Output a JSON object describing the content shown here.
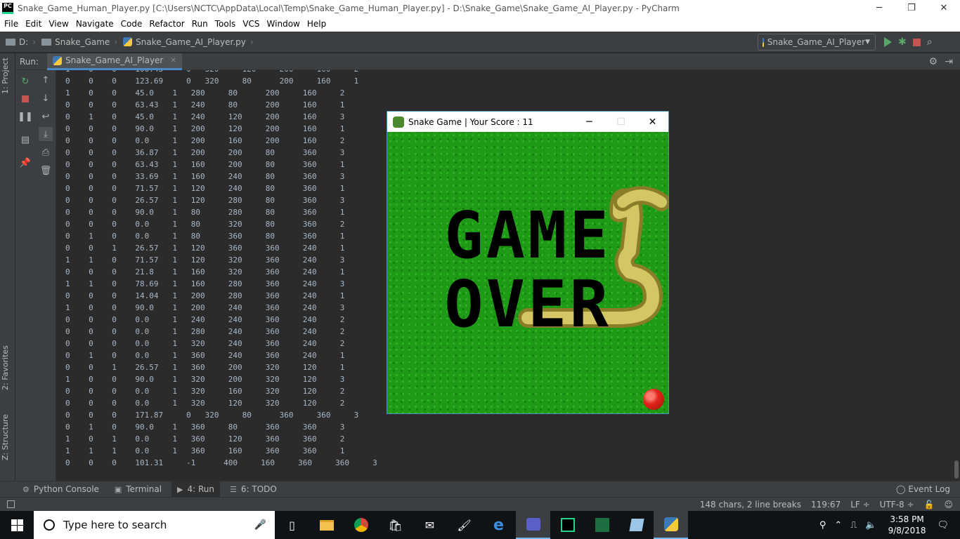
{
  "window": {
    "title": "Snake_Game_Human_Player.py [C:\\Users\\NCTC\\AppData\\Local\\Temp\\Snake_Game_Human_Player.py] - D:\\Snake_Game\\Snake_Game_AI_Player.py - PyCharm",
    "minimize": "─",
    "restore": "❐",
    "close": "✕"
  },
  "menu": [
    "File",
    "Edit",
    "View",
    "Navigate",
    "Code",
    "Refactor",
    "Run",
    "Tools",
    "VCS",
    "Window",
    "Help"
  ],
  "breadcrumb": {
    "drive": "D:",
    "folder": "Snake_Game",
    "file": "Snake_Game_AI_Player.py"
  },
  "run_config": "Snake_Game_AI_Player",
  "left_tabs": {
    "project": "1: Project",
    "favorites": "2: Favorites",
    "structure": "Z: Structure"
  },
  "run_panel": {
    "label": "Run:",
    "tab": "Snake_Game_AI_Player"
  },
  "console_lines": [
    "0    0    0    123.69     0   320     80      200     160     1",
    "1    0    0    45.0    1   280     80      200     160     2",
    "0    0    0    63.43   1   240     80      200     160     1",
    "0    1    0    45.0    1   240     120     200     160     3",
    "0    0    0    90.0    1   200     120     200     160     1",
    "0    0    0    0.0     1   200     160     200     160     2",
    "0    0    0    36.87   1   200     200     80      360     3",
    "0    0    0    63.43   1   160     200     80      360     1",
    "0    0    0    33.69   1   160     240     80      360     3",
    "0    0    0    71.57   1   120     240     80      360     1",
    "0    0    0    26.57   1   120     280     80      360     3",
    "0    0    0    90.0    1   80      280     80      360     1",
    "0    0    0    0.0     1   80      320     80      360     2",
    "0    1    0    0.0     1   80      360     80      360     1",
    "0    0    1    26.57   1   120     360     360     240     1",
    "1    1    0    71.57   1   120     320     360     240     3",
    "0    0    0    21.8    1   160     320     360     240     1",
    "1    1    0    78.69   1   160     280     360     240     3",
    "0    0    0    14.04   1   200     280     360     240     1",
    "1    0    0    90.0    1   200     240     360     240     3",
    "0    0    0    0.0     1   240     240     360     240     2",
    "0    0    0    0.0     1   280     240     360     240     2",
    "0    0    0    0.0     1   320     240     360     240     2",
    "0    1    0    0.0     1   360     240     360     240     1",
    "0    0    1    26.57   1   360     200     320     120     1",
    "1    0    0    90.0    1   320     200     320     120     3",
    "0    0    0    0.0     1   320     160     320     120     2",
    "0    0    0    0.0     1   320     120     320     120     2",
    "0    0    0    171.87     0   320     80      360     360     3",
    "0    1    0    90.0    1   360     80      360     360     3",
    "1    0    1    0.0     1   360     120     360     360     2",
    "1    1    1    0.0     1   360     160     360     360     1",
    "0    0    0    101.31     -1      400     160     360     360     3"
  ],
  "game_window": {
    "title": "Snake Game | Your Score : 11",
    "line1": "GAME",
    "line2": "OVER"
  },
  "bottom_tabs": {
    "python_console": "Python Console",
    "terminal": "Terminal",
    "run": "4: Run",
    "todo": "6: TODO",
    "event_log": "Event Log"
  },
  "status": {
    "chars": "148 chars, 2 line breaks",
    "position": "119:67",
    "line_sep": "LF ÷",
    "encoding": "UTF-8 ÷"
  },
  "taskbar": {
    "search_placeholder": "Type here to search",
    "time": "3:58 PM",
    "date": "9/8/2018"
  },
  "colors": {
    "ide_bg": "#2b2b2b",
    "panel_bg": "#3c3f41",
    "grass": "#1f9a17",
    "snake": "#d4c565",
    "apple": "#e0261c"
  }
}
